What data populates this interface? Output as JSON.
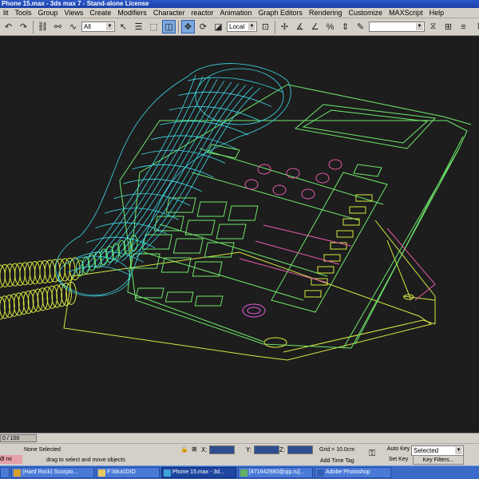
{
  "window": {
    "title": "Phone 15.max - 3ds max 7 - Stand-alone License"
  },
  "menubar": {
    "items": [
      "lit",
      "Tools",
      "Group",
      "Views",
      "Create",
      "Modifiers",
      "Character",
      "reactor",
      "Animation",
      "Graph Editors",
      "Rendering",
      "Customize",
      "MAXScript",
      "Help"
    ]
  },
  "toolbar": {
    "selection_filter": "All",
    "reference_coord": "Local",
    "named_selection": ""
  },
  "timeslider": {
    "label": "0 / 100"
  },
  "status": {
    "selection": "None Selected",
    "prompt": "drag to select and move objects",
    "left_prompt": "Ø mi",
    "x_label": "X:",
    "y_label": "Y:",
    "z_label": "Z:",
    "grid": "Grid = 10.0cm",
    "add_time_tag": "Add Time Tag",
    "auto_key": "Auto Key",
    "set_key": "Set Key",
    "key_mode": "Selected",
    "key_filters": "Key Filters..."
  },
  "taskbar": {
    "items": [
      {
        "label": "(Hard Rock) Scorpio...",
        "color": "#d8a030"
      },
      {
        "label": "F:\\Mus\\DIO",
        "color": "#e8c860"
      },
      {
        "label": "Phone 15.max - 3d...",
        "color": "#40a0d8",
        "active": true
      },
      {
        "label": "[471642980@qip.ru]...",
        "color": "#60b060"
      },
      {
        "label": "Adobe Photoshop",
        "color": "#3060b0"
      }
    ]
  },
  "colors": {
    "wire_cyan": "#3fd8e8",
    "wire_green": "#6fe86a",
    "wire_yellow": "#d8e840",
    "wire_pink": "#e85aa8",
    "wire_magenta": "#e060e0"
  }
}
